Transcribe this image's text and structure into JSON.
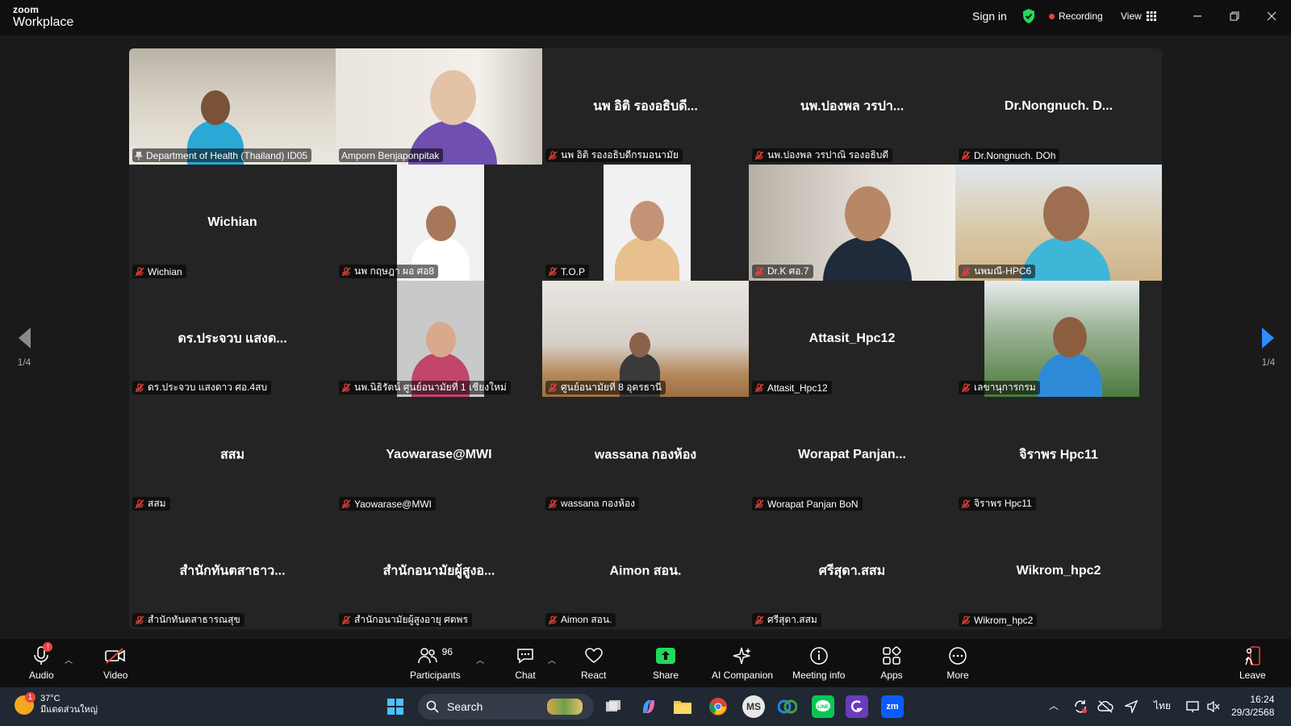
{
  "app": {
    "brand_top": "zoom",
    "brand_bottom": "Workplace"
  },
  "titlebar": {
    "sign_in": "Sign in",
    "recording": "Recording",
    "view": "View"
  },
  "pagination": {
    "left": "1/4",
    "right": "1/4"
  },
  "participants": [
    {
      "label": "Department of Health (Thailand) ID05",
      "big": "",
      "video": true,
      "pinned": true,
      "active": true,
      "muted": false
    },
    {
      "label": "Amporn Benjaponpitak",
      "big": "",
      "video": true,
      "muted": false
    },
    {
      "label": "นพ อิติ รองอธิบดีกรมอนามัย",
      "big": "นพ อิติ รองอธิบดี...",
      "video": false,
      "muted": true
    },
    {
      "label": "นพ.ปองพล วรปาณิ รองอธิบดี",
      "big": "นพ.ปองพล วรปา...",
      "video": false,
      "muted": true
    },
    {
      "label": "Dr.Nongnuch. DOh",
      "big": "Dr.Nongnuch.  D...",
      "video": false,
      "muted": true
    },
    {
      "label": "Wichian",
      "big": "Wichian",
      "video": false,
      "muted": true
    },
    {
      "label": "นพ กฤษฎา ผอ ศอ8",
      "big": "",
      "video": true,
      "muted": true
    },
    {
      "label": "T.O.P",
      "big": "",
      "video": true,
      "muted": true
    },
    {
      "label": "Dr.K ศอ.7",
      "big": "",
      "video": true,
      "muted": true
    },
    {
      "label": "นพมณี-HPC6",
      "big": "",
      "video": true,
      "muted": true
    },
    {
      "label": "ดร.ประจวบ แสงดาว ศอ.4สบ",
      "big": "ดร.ประจวบ แสงด...",
      "video": false,
      "muted": true
    },
    {
      "label": "นพ.นิธิรัตน์ ศูนย์อนามัยที่ 1 เชียงใหม่",
      "big": "",
      "video": true,
      "muted": true
    },
    {
      "label": "ศูนย์อนามัยที่ 8 อุดรธานี",
      "big": "",
      "video": true,
      "muted": true
    },
    {
      "label": "Attasit_Hpc12",
      "big": "Attasit_Hpc12",
      "video": false,
      "muted": true
    },
    {
      "label": "เลขานุการกรม",
      "big": "",
      "video": true,
      "muted": true
    },
    {
      "label": "สสม",
      "big": "สสม",
      "video": false,
      "muted": true
    },
    {
      "label": "Yaowarase@MWI",
      "big": "Yaowarase@MWI",
      "video": false,
      "muted": true
    },
    {
      "label": "wassana กองห้อง",
      "big": "wassana กองห้อง",
      "video": false,
      "muted": true
    },
    {
      "label": "Worapat Panjan BoN",
      "big": "Worapat  Panjan...",
      "video": false,
      "muted": true
    },
    {
      "label": "จิราพร Hpc11",
      "big": "จิราพร Hpc11",
      "video": false,
      "muted": true
    },
    {
      "label": "สำนักทันตสาธารณสุข",
      "big": "สำนักทันตสาธาว...",
      "video": false,
      "muted": true
    },
    {
      "label": "สำนักอนามัยผู้สูงอายุ ศตพร",
      "big": "สำนักอนามัยผู้สูงอ...",
      "video": false,
      "muted": true
    },
    {
      "label": "Aimon สอน.",
      "big": "Aimon สอน.",
      "video": false,
      "muted": true
    },
    {
      "label": "ศรีสุดา.สสม",
      "big": "ศรีสุดา.สสม",
      "video": false,
      "muted": true
    },
    {
      "label": "Wikrom_hpc2",
      "big": "Wikrom_hpc2",
      "video": false,
      "muted": true
    }
  ],
  "toolbar": {
    "audio": "Audio",
    "audio_badge": "!",
    "video": "Video",
    "participants": "Participants",
    "participants_count": "96",
    "chat": "Chat",
    "react": "React",
    "share": "Share",
    "ai": "AI Companion",
    "meeting_info": "Meeting info",
    "apps": "Apps",
    "more": "More",
    "leave": "Leave"
  },
  "taskbar": {
    "temp": "37°C",
    "weather_desc": "มีแดดส่วนใหญ่",
    "weather_badge": "1",
    "search": "Search",
    "lang": "ไทย",
    "time": "16:24",
    "date": "29/3/2568",
    "ms_label": "MS",
    "zm_label": "zm"
  },
  "colors": {
    "active_border": "#23d959",
    "mute_red": "#e8453c",
    "share_green": "#23d959",
    "accent_blue": "#2d8cff"
  }
}
